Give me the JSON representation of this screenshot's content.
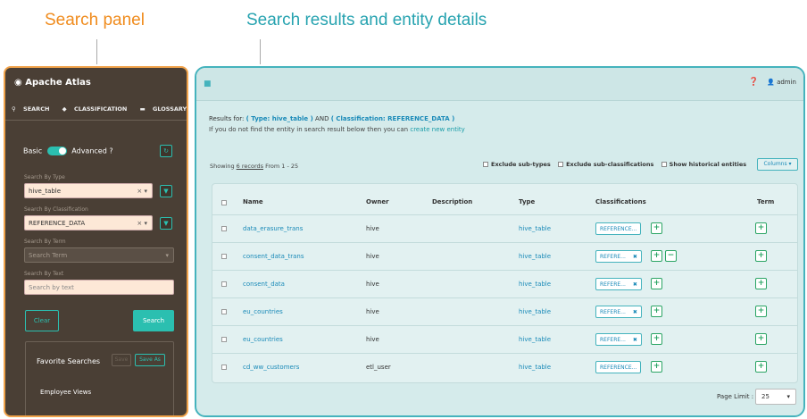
{
  "captions": {
    "left": "Search panel",
    "right": "Search results and entity details"
  },
  "left_panel": {
    "brand": "Apache Atlas",
    "tabs": [
      "SEARCH",
      "CLASSIFICATION",
      "GLOSSARY"
    ],
    "toggle": {
      "basic": "Basic",
      "advanced": "Advanced"
    },
    "search_by_type": {
      "label": "Search By Type",
      "value": "hive_table"
    },
    "search_by_classification": {
      "label": "Search By Classification",
      "value": "REFERENCE_DATA"
    },
    "search_by_term": {
      "label": "Search By Term",
      "placeholder": "Search Term"
    },
    "search_by_text": {
      "label": "Search By Text",
      "placeholder": "Search by text"
    },
    "clear": "Clear",
    "search": "Search",
    "favorites": {
      "title": "Favorite Searches",
      "save": "Save",
      "save_as": "Save As",
      "item": "Employee Views"
    }
  },
  "right_panel": {
    "user": "admin",
    "results_for_prefix": "Results for:",
    "results_for_type": "( Type: hive_table )",
    "results_for_and": "AND",
    "results_for_class": "( Classification: REFERENCE_DATA )",
    "if_not_found": "If you do not find the entity in search result below then you can",
    "create_link": "create new entity",
    "showing_prefix": "Showing",
    "showing_records": "6 records",
    "showing_suffix": "From 1 - 25",
    "options": [
      "Exclude sub-types",
      "Exclude sub-classifications",
      "Show historical entities"
    ],
    "columns_btn": "Columns ▾",
    "headers": [
      "Name",
      "Owner",
      "Description",
      "Type",
      "Classifications",
      "Term"
    ],
    "rows": [
      {
        "name": "data_erasure_trans",
        "owner": "hive",
        "type": "hive_table",
        "tag": "REFERENCE..."
      },
      {
        "name": "consent_data_trans",
        "owner": "hive",
        "type": "hive_table",
        "tag": "REFERE..."
      },
      {
        "name": "consent_data",
        "owner": "hive",
        "type": "hive_table",
        "tag": "REFERE..."
      },
      {
        "name": "eu_countries",
        "owner": "hive",
        "type": "hive_table",
        "tag": "REFERE..."
      },
      {
        "name": "eu_countries",
        "owner": "hive",
        "type": "hive_table",
        "tag": "REFERE..."
      },
      {
        "name": "cd_ww_customers",
        "owner": "etl_user",
        "type": "hive_table",
        "tag": "REFERENCE..."
      }
    ],
    "page_limit_label": "Page Limit :",
    "page_limit_value": "25"
  },
  "colors": {
    "accent": "#2bbfb0",
    "panel_dark": "#4a3f35",
    "link": "#1a8ab8",
    "orange": "#f08c1e"
  }
}
